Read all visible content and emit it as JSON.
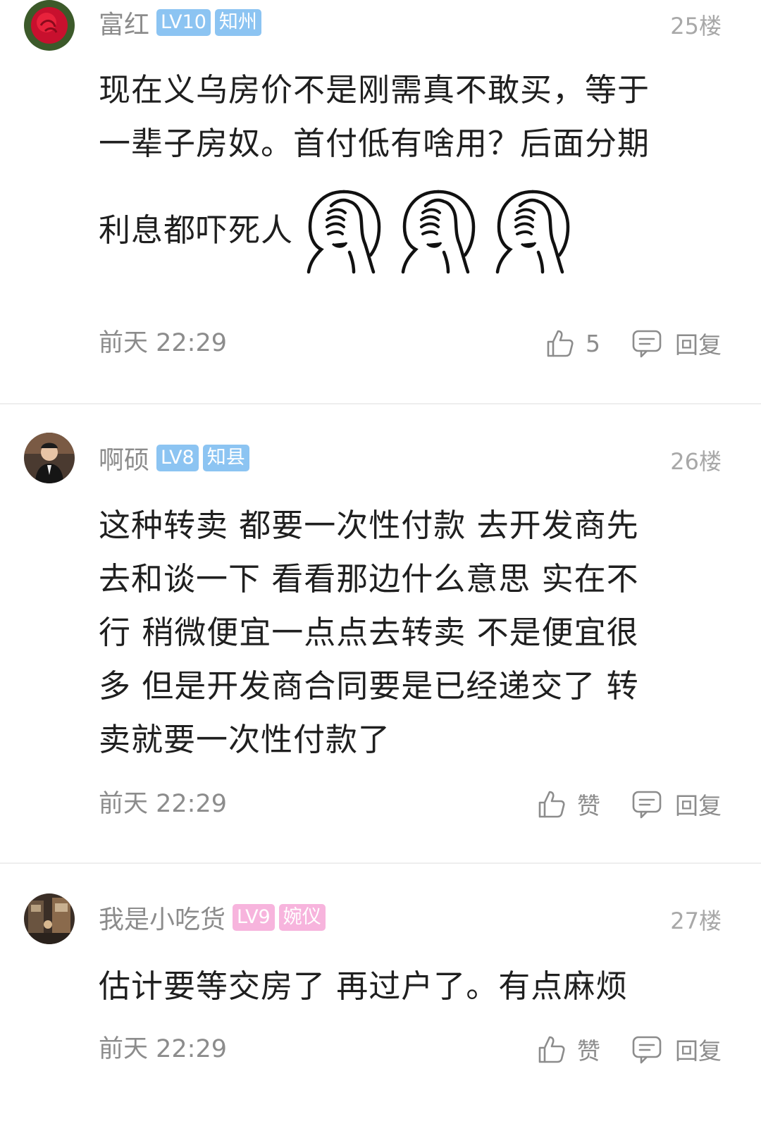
{
  "comments": [
    {
      "username": "富红",
      "level": "LV10",
      "title": "知州",
      "floor": "25楼",
      "text_lines": [
        "现在义乌房价不是刚需真不敢买，等于",
        "一辈子房奴。首付低有啥用？后面分期",
        "利息都吓死人"
      ],
      "time": "前天 22:29",
      "likes": "5",
      "reply": "回复",
      "emoji": "facepalm-icon",
      "badge_color": "#8cc4f2"
    },
    {
      "username": "啊硕",
      "level": "LV8",
      "title": "知县",
      "floor": "26楼",
      "text_lines": [
        "这种转卖 都要一次性付款  去开发商先",
        "去和谈一下 看看那边什么意思 实在不",
        "行 稍微便宜一点点去转卖  不是便宜很",
        "多 但是开发商合同要是已经递交了 转",
        "卖就要一次性付款了"
      ],
      "time": "前天 22:29",
      "likes": "赞",
      "reply": "回复",
      "badge_color": "#8cc4f2"
    },
    {
      "username": "我是小吃货",
      "level": "LV9",
      "title": "婉仪",
      "floor": "27楼",
      "text_lines": [
        "估计要等交房了 再过户了。有点麻烦"
      ],
      "time": "前天 22:29",
      "likes": "赞",
      "reply": "回复",
      "badge_color": "#f7b4dd"
    }
  ]
}
